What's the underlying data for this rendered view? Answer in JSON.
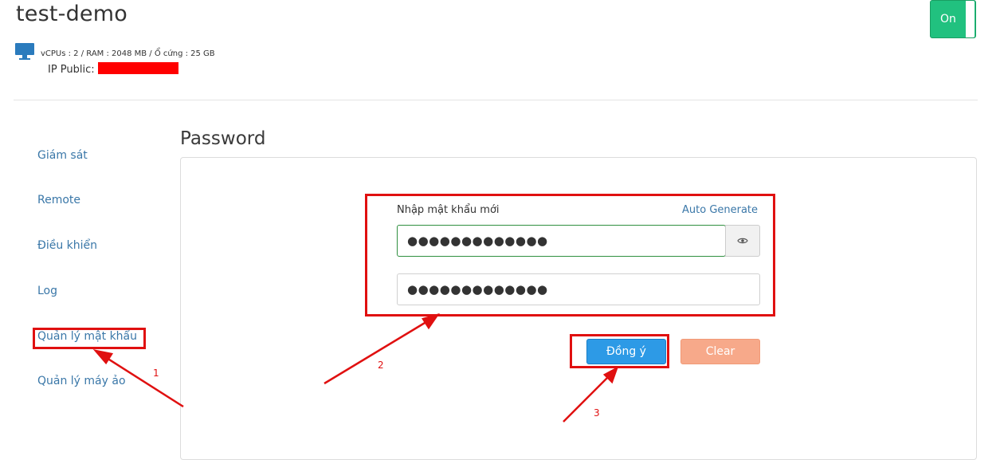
{
  "header": {
    "title": "test-demo",
    "specs": "vCPUs : 2 / RAM : 2048 MB / Ổ cứng : 25 GB",
    "ip_label": "IP Public:",
    "power_toggle": "On"
  },
  "sidebar": {
    "items": [
      {
        "label": "Giám sát"
      },
      {
        "label": "Remote"
      },
      {
        "label": "Điều khiển"
      },
      {
        "label": "Log"
      },
      {
        "label": "Quản lý mật khẩu"
      },
      {
        "label": "Quản lý máy ảo"
      }
    ]
  },
  "main": {
    "section_title": "Password",
    "new_password_label": "Nhập mật khẩu mới",
    "auto_generate": "Auto Generate",
    "password_value": "●●●●●●●●●●●●●",
    "confirm_value": "●●●●●●●●●●●●●",
    "agree_button": "Đồng ý",
    "clear_button": "Clear"
  },
  "annotations": {
    "step1": "1",
    "step2": "2",
    "step3": "3"
  },
  "colors": {
    "toggle_on": "#21c17f",
    "link": "#3a77a8",
    "primary": "#2d9ae6",
    "clear": "#f7a98a",
    "annotation": "#e01010"
  }
}
